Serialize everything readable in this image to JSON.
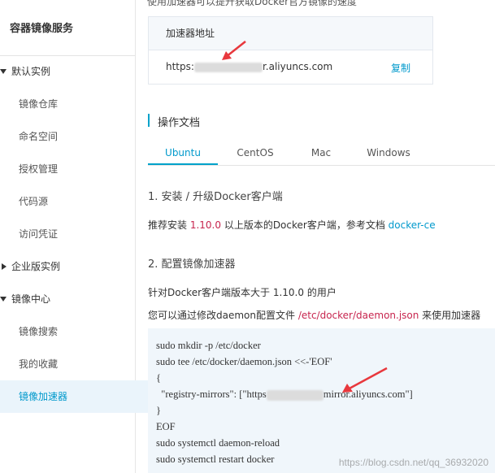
{
  "sidebar": {
    "title": "容器镜像服务",
    "items": [
      {
        "label": "默认实例",
        "kind": "group",
        "expanded": true
      },
      {
        "label": "镜像仓库",
        "kind": "sub"
      },
      {
        "label": "命名空间",
        "kind": "sub"
      },
      {
        "label": "授权管理",
        "kind": "sub"
      },
      {
        "label": "代码源",
        "kind": "sub"
      },
      {
        "label": "访问凭证",
        "kind": "sub"
      },
      {
        "label": "企业版实例",
        "kind": "group",
        "expanded": false
      },
      {
        "label": "镜像中心",
        "kind": "group",
        "expanded": true
      },
      {
        "label": "镜像搜索",
        "kind": "sub"
      },
      {
        "label": "我的收藏",
        "kind": "sub"
      },
      {
        "label": "镜像加速器",
        "kind": "sub",
        "active": true
      }
    ]
  },
  "top_text": "使用加速器可以提升获取Docker官方镜像的速度",
  "accelerator": {
    "header": "加速器地址",
    "url_prefix": "https:",
    "url_suffix": "r.aliyuncs.com",
    "copy_label": "复制"
  },
  "docs": {
    "title": "操作文档",
    "tabs": [
      "Ubuntu",
      "CentOS",
      "Mac",
      "Windows"
    ],
    "active_tab": "Ubuntu",
    "step1_title": "1. 安装 / 升级Docker客户端",
    "step1_text_a": "推荐安装 ",
    "step1_version": "1.10.0",
    "step1_text_b": " 以上版本的Docker客户端，参考文档 ",
    "step1_link": "docker-ce",
    "step2_title": "2. 配置镜像加速器",
    "step2_line1": "针对Docker客户端版本大于 1.10.0 的用户",
    "step2_line2_a": "您可以通过修改daemon配置文件 ",
    "step2_path": "/etc/docker/daemon.json",
    "step2_line2_b": " 来使用加速器",
    "code": {
      "l1": "sudo mkdir -p /etc/docker",
      "l2": "sudo tee /etc/docker/daemon.json <<-'EOF'",
      "l3": "{",
      "l4_a": "  \"registry-mirrors\": [\"https",
      "l4_b": "mirror.aliyuncs.com\"]",
      "l5": "}",
      "l6": "EOF",
      "l7": "sudo systemctl daemon-reload",
      "l8": "sudo systemctl restart docker"
    }
  },
  "watermark": "https://blog.csdn.net/qq_36932020",
  "colors": {
    "accent": "#00a2ca",
    "link": "#0099cc",
    "active_bg": "#eaf4fb",
    "code_bg": "#f0f6fb",
    "arrow": "#e8383d"
  }
}
